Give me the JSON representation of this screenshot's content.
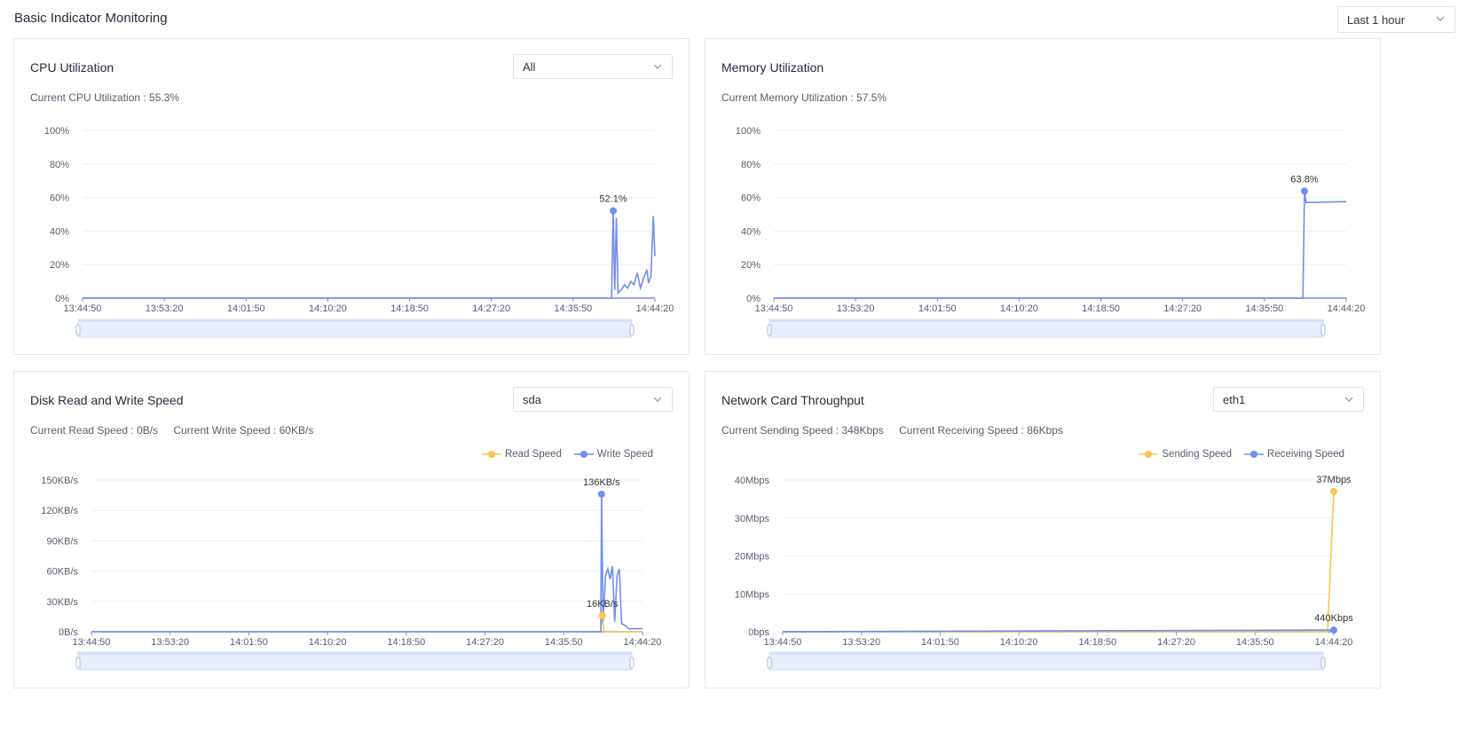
{
  "page": {
    "title": "Basic Indicator Monitoring",
    "time_range": "Last 1 hour"
  },
  "x_ticks": [
    "13:44:50",
    "13:53:20",
    "14:01:50",
    "14:10:20",
    "14:18:50",
    "14:27:20",
    "14:35:50",
    "14:44:20"
  ],
  "colors": {
    "blue": "#6f8ef0",
    "yellow": "#f7c64f",
    "grid": "#ebedf0",
    "axis": "#6f8ef0"
  },
  "panels": {
    "cpu": {
      "title": "CPU Utilization",
      "select": "All",
      "status": "Current CPU Utilization : 55.3%"
    },
    "memory": {
      "title": "Memory Utilization",
      "status": "Current Memory Utilization : 57.5%"
    },
    "disk": {
      "title": "Disk Read and Write Speed",
      "select": "sda",
      "read_status": "Current Read Speed : 0B/s",
      "write_status": "Current Write Speed : 60KB/s",
      "legend": [
        "Read Speed",
        "Write Speed"
      ]
    },
    "network": {
      "title": "Network Card Throughput",
      "select": "eth1",
      "send_status": "Current Sending Speed : 348Kbps",
      "recv_status": "Current Receiving Speed : 86Kbps",
      "legend": [
        "Sending Speed",
        "Receiving Speed"
      ]
    }
  },
  "chart_data": [
    {
      "id": "cpu",
      "type": "line",
      "title": "CPU Utilization",
      "y_ticks": [
        "0%",
        "20%",
        "40%",
        "60%",
        "80%",
        "100%"
      ],
      "ylim": [
        0,
        100
      ],
      "xlim": [
        0,
        3570
      ],
      "series": [
        {
          "color": "blue",
          "points": [
            [
              0,
              0
            ],
            [
              3300,
              0
            ],
            [
              3310,
              52.1
            ],
            [
              3320,
              5
            ],
            [
              3330,
              48
            ],
            [
              3340,
              3
            ],
            [
              3360,
              5
            ],
            [
              3380,
              8
            ],
            [
              3400,
              6
            ],
            [
              3420,
              10
            ],
            [
              3440,
              8
            ],
            [
              3460,
              15
            ],
            [
              3480,
              6
            ],
            [
              3500,
              12
            ],
            [
              3520,
              17
            ],
            [
              3530,
              9
            ],
            [
              3545,
              13
            ],
            [
              3560,
              49
            ],
            [
              3570,
              25
            ]
          ]
        }
      ],
      "annotations": [
        {
          "x": 3310,
          "y": 52.1,
          "label": "52.1%",
          "color": "blue"
        }
      ],
      "grid": true
    },
    {
      "id": "memory",
      "type": "line",
      "title": "Memory Utilization",
      "y_ticks": [
        "0%",
        "20%",
        "40%",
        "60%",
        "80%",
        "100%"
      ],
      "ylim": [
        0,
        100
      ],
      "xlim": [
        0,
        3570
      ],
      "series": [
        {
          "color": "blue",
          "points": [
            [
              0,
              0
            ],
            [
              3300,
              0
            ],
            [
              3310,
              63.8
            ],
            [
              3320,
              57
            ],
            [
              3450,
              57.3
            ],
            [
              3570,
              57.5
            ]
          ]
        }
      ],
      "annotations": [
        {
          "x": 3310,
          "y": 63.8,
          "label": "63.8%",
          "color": "blue"
        }
      ],
      "grid": true
    },
    {
      "id": "disk",
      "type": "line",
      "title": "Disk Read and Write Speed",
      "y_ticks": [
        "0B/s",
        "30KB/s",
        "60KB/s",
        "90KB/s",
        "120KB/s",
        "150KB/s"
      ],
      "ylim": [
        0,
        150
      ],
      "xlim": [
        0,
        3570
      ],
      "series": [
        {
          "name": "Read Speed",
          "color": "yellow",
          "points": [
            [
              0,
              0
            ],
            [
              3300,
              0
            ],
            [
              3310,
              16
            ],
            [
              3320,
              0
            ],
            [
              3570,
              0
            ]
          ]
        },
        {
          "name": "Write Speed",
          "color": "blue",
          "points": [
            [
              0,
              0
            ],
            [
              3300,
              0
            ],
            [
              3305,
              136
            ],
            [
              3315,
              10
            ],
            [
              3330,
              55
            ],
            [
              3345,
              62
            ],
            [
              3360,
              52
            ],
            [
              3375,
              65
            ],
            [
              3390,
              10
            ],
            [
              3405,
              55
            ],
            [
              3420,
              62
            ],
            [
              3435,
              8
            ],
            [
              3460,
              6
            ],
            [
              3480,
              3
            ],
            [
              3520,
              3
            ],
            [
              3570,
              3
            ]
          ]
        }
      ],
      "annotations": [
        {
          "x": 3305,
          "y": 136,
          "label": "136KB/s",
          "color": "blue"
        },
        {
          "x": 3310,
          "y": 16,
          "label": "16KB/s",
          "color": "yellow"
        }
      ],
      "grid": true
    },
    {
      "id": "network",
      "type": "line",
      "title": "Network Card Throughput",
      "y_ticks": [
        "0bps",
        "10Mbps",
        "20Mbps",
        "30Mbps",
        "40Mbps"
      ],
      "ylim": [
        0,
        40
      ],
      "xlim": [
        0,
        3570
      ],
      "series": [
        {
          "name": "Sending Speed",
          "color": "yellow",
          "points": [
            [
              0,
              0
            ],
            [
              3530,
              0
            ],
            [
              3570,
              37
            ]
          ]
        },
        {
          "name": "Receiving Speed",
          "color": "blue",
          "points": [
            [
              0,
              0
            ],
            [
              3570,
              0.44
            ]
          ]
        }
      ],
      "annotations": [
        {
          "x": 3570,
          "y": 37,
          "label": "37Mbps",
          "color": "yellow"
        },
        {
          "x": 3570,
          "y": 0.44,
          "label": "440Kbps",
          "color": "blue"
        }
      ],
      "grid": true
    }
  ]
}
